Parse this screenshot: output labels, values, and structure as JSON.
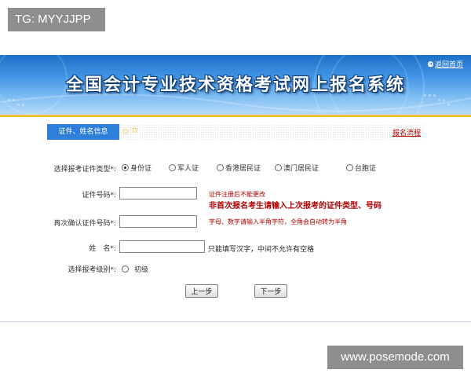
{
  "watermarks": {
    "top": "TG: MYYJJPP",
    "bottom": "www.posemode.com"
  },
  "header": {
    "title": "全国会计专业技术资格考试网上报名系统",
    "back_link": "返回首页"
  },
  "tabs": {
    "active_label": "证件、姓名信息",
    "process_link": "报名流程"
  },
  "form": {
    "id_type": {
      "label": "选择报考证件类型*:",
      "options": [
        "身份证",
        "军人证",
        "香港居民证",
        "澳门居民证",
        "台胞证"
      ],
      "selected": "身份证"
    },
    "id_number": {
      "label": "证件号码*:",
      "value": "",
      "note_line1": "证件注册后不能更改",
      "note_line2": "非首次报名考生请输入上次报考的证件类型、号码"
    },
    "id_confirm": {
      "label": "再次确认证件号码*:",
      "value": "",
      "note": "字母、数字请输入半角字符，全角会自动转为半角"
    },
    "name": {
      "label": "姓　名*:",
      "value": "",
      "note": "只能填写汉字，中间不允许有空格"
    },
    "level": {
      "label": "选择报考级别*:",
      "options": [
        "初级"
      ]
    }
  },
  "buttons": {
    "prev": "上一步",
    "next": "下一步"
  },
  "colors": {
    "banner": "#2f7fd8",
    "accent_red": "#b00000",
    "gold": "#f0c23a"
  },
  "icons": {
    "back": "arrow-circle-icon",
    "tab_star": "star-icon"
  }
}
